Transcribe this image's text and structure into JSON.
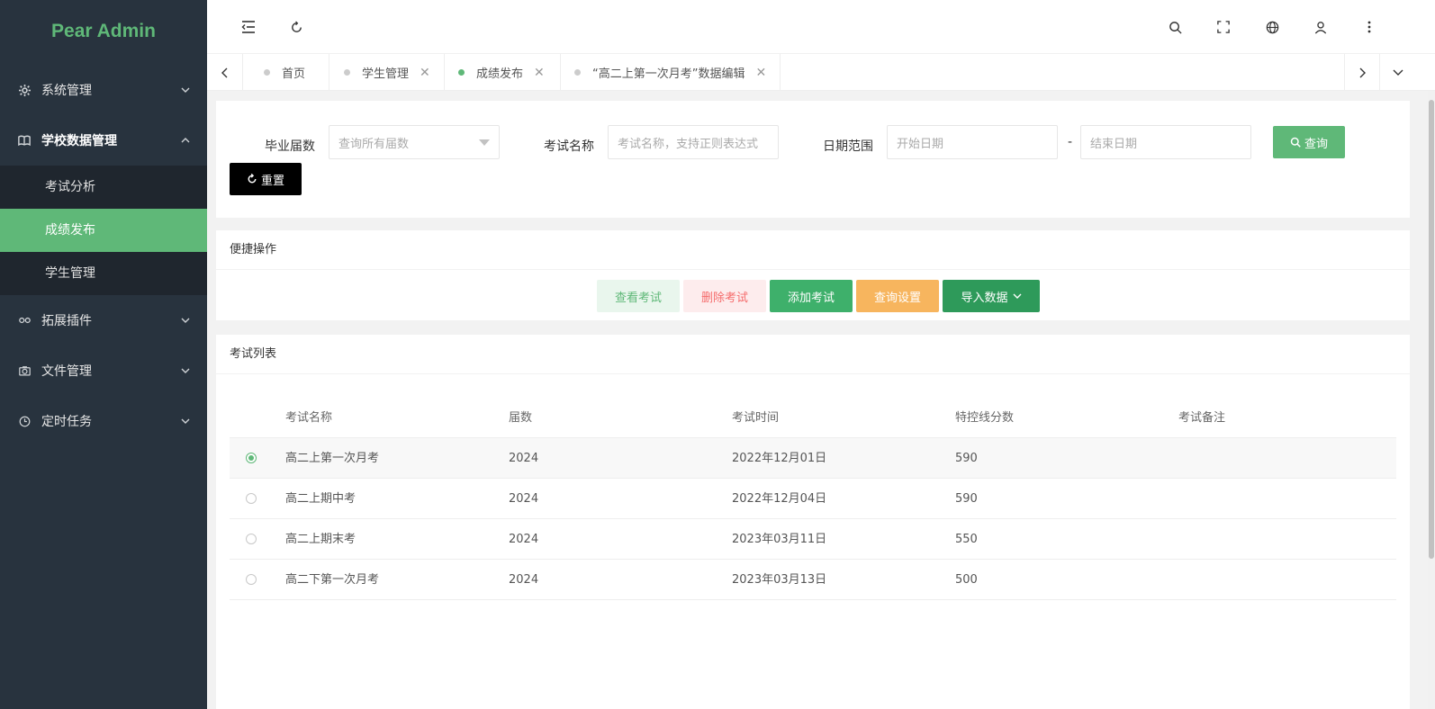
{
  "logo": "Pear Admin",
  "sidebar": {
    "items": [
      {
        "label": "系统管理",
        "icon": "gear-icon"
      },
      {
        "label": "学校数据管理",
        "icon": "book-icon"
      },
      {
        "label": "拓展插件",
        "icon": "plugin-icon"
      },
      {
        "label": "文件管理",
        "icon": "camera-icon"
      },
      {
        "label": "定时任务",
        "icon": "clock-icon"
      }
    ],
    "sub": [
      {
        "label": "考试分析"
      },
      {
        "label": "成绩发布"
      },
      {
        "label": "学生管理"
      }
    ]
  },
  "tabs": [
    {
      "label": "首页"
    },
    {
      "label": "学生管理"
    },
    {
      "label": "成绩发布"
    },
    {
      "label": "“高二上第一次月考”数据编辑"
    }
  ],
  "search": {
    "grade_label": "毕业届数",
    "grade_placeholder": "查询所有届数",
    "name_label": "考试名称",
    "name_placeholder": "考试名称，支持正则表达式",
    "date_label": "日期范围",
    "start_placeholder": "开始日期",
    "date_sep": "-",
    "end_placeholder": "结束日期",
    "query_label": "查询",
    "reset_label": "重置"
  },
  "quick": {
    "title": "便捷操作",
    "view": "查看考试",
    "delete": "删除考试",
    "add": "添加考试",
    "settings": "查询设置",
    "import": "导入数据"
  },
  "exam_list": {
    "title": "考试列表",
    "headers": [
      "考试名称",
      "届数",
      "考试时间",
      "特控线分数",
      "考试备注"
    ],
    "rows": [
      {
        "name": "高二上第一次月考",
        "grade": "2024",
        "date": "2022年12月01日",
        "score": "590",
        "note": "",
        "selected": true
      },
      {
        "name": "高二上期中考",
        "grade": "2024",
        "date": "2022年12月04日",
        "score": "590",
        "note": "",
        "selected": false
      },
      {
        "name": "高二上期末考",
        "grade": "2024",
        "date": "2023年03月11日",
        "score": "550",
        "note": "",
        "selected": false
      },
      {
        "name": "高二下第一次月考",
        "grade": "2024",
        "date": "2023年03月13日",
        "score": "500",
        "note": "",
        "selected": false
      }
    ]
  },
  "colors": {
    "accent": "#5fb878",
    "sidebar": "#28333e",
    "submenu": "#1f262e",
    "warn": "#f7b55e",
    "danger_bg": "#fdeced",
    "success_bg": "#e9f6ed"
  }
}
